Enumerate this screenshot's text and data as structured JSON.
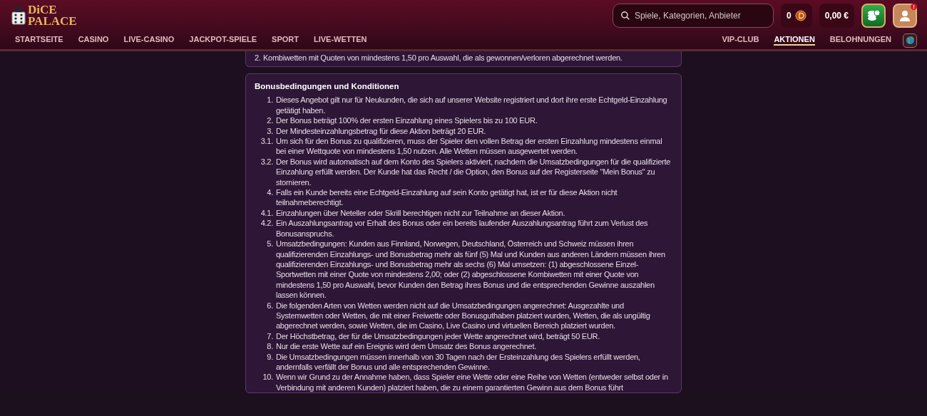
{
  "header": {
    "logo": {
      "line1": "DiCE",
      "line2": "PALACE"
    },
    "search": {
      "placeholder": "Spiele, Kategorien, Anbieter"
    },
    "coins": "0",
    "balance": "0,00 €",
    "notification": "!",
    "nav_left": [
      {
        "label": "STARTSEITE",
        "selected": false
      },
      {
        "label": "CASINO",
        "selected": false
      },
      {
        "label": "LIVE-CASINO",
        "selected": false
      },
      {
        "label": "JACKPOT-SPIELE",
        "selected": false
      },
      {
        "label": "SPORT",
        "selected": false
      },
      {
        "label": "LIVE-WETTEN",
        "selected": false
      }
    ],
    "nav_right": [
      {
        "label": "VIP-CLUB",
        "selected": false
      },
      {
        "label": "AKTIONEN",
        "selected": true
      },
      {
        "label": "BELOHNUNGEN",
        "selected": false
      }
    ]
  },
  "top_card": {
    "items": [
      {
        "number": "2.",
        "text": "Kombiwetten mit Quoten von mindestens 1,50 pro Auswahl, die als gewonnen/verloren abgerechnet werden."
      }
    ]
  },
  "terms_card": {
    "title": "Bonusbedingungen und Konditionen",
    "items": [
      {
        "number": "1.",
        "text": "Dieses Angebot gilt nur für Neukunden, die sich auf unserer Website registriert und dort ihre erste Echtgeld-Einzahlung getätigt haben."
      },
      {
        "number": "2.",
        "text": "Der Bonus beträgt 100% der ersten Einzahlung eines Spielers bis zu 100 EUR."
      },
      {
        "number": "3.",
        "text": "Der Mindesteinzahlungsbetrag für diese Aktion beträgt 20 EUR."
      },
      {
        "number": "3.1.",
        "text": "Um sich für den Bonus zu qualifizieren, muss der Spieler den vollen Betrag der ersten Einzahlung mindestens einmal bei einer Wettquote von mindestens 1,50 nutzen. Alle Wetten müssen ausgewertet werden."
      },
      {
        "number": "3.2.",
        "text": "Der Bonus wird automatisch auf dem Konto des Spielers aktiviert, nachdem die Umsatzbedingungen für die qualifizierte Einzahlung erfüllt werden. Der Kunde hat das Recht / die Option, den Bonus auf der Registerseite \"Mein Bonus\" zu stornieren."
      },
      {
        "number": "4.",
        "text": "Falls ein Kunde bereits eine Echtgeld-Einzahlung auf sein Konto getätigt hat, ist er für diese Aktion nicht teilnahmeberechtigt."
      },
      {
        "number": "4.1.",
        "text": "Einzahlungen über Neteller oder Skrill berechtigen nicht zur Teilnahme an dieser Aktion."
      },
      {
        "number": "4.2.",
        "text": "Ein Auszahlungsantrag vor Erhalt des Bonus oder ein bereits laufender Auszahlungsantrag führt zum Verlust des Bonusanspruchs."
      },
      {
        "number": "5.",
        "text": "Umsatzbedingungen: Kunden aus Finnland, Norwegen, Deutschland, Österreich und Schweiz müssen ihren qualifizierenden Einzahlungs- und Bonusbetrag mehr als fünf (5) Mal und Kunden aus anderen Ländern müssen ihren qualifizierenden Einzahlungs- und Bonusbetrag mehr als sechs (6) Mal umsetzen: (1) abgeschlossene Einzel-Sportwetten mit einer Quote von mindestens 2,00; oder (2) abgeschlossene Kombiwetten mit einer Quote von mindestens 1,50 pro Auswahl, bevor Kunden den Betrag ihres Bonus und die entsprechenden Gewinne auszahlen lassen können."
      },
      {
        "number": "6.",
        "text": "Die folgenden Arten von Wetten werden nicht auf die Umsatzbedingungen angerechnet: Ausgezahlte und Systemwetten oder Wetten, die mit einer Freiwette oder Bonusguthaben platziert wurden, Wetten, die als ungültig abgerechnet werden, sowie Wetten, die im Casino, Live Casino und virtuellen Bereich platziert wurden."
      },
      {
        "number": "7.",
        "text": "Der Höchstbetrag, der für die Umsatzbedingungen jeder Wette angerechnet wird, beträgt 50 EUR."
      },
      {
        "number": "8.",
        "text": "Nur die erste Wette auf ein Ereignis wird dem Umsatz des Bonus angerechnet."
      },
      {
        "number": "9.",
        "text": "Die Umsatzbedingungen müssen innerhalb von 30 Tagen nach der Ersteinzahlung des Spielers erfüllt werden, andernfalls verfällt der Bonus und alle entsprechenden Gewinne."
      },
      {
        "number": "10.",
        "text": "Wenn wir Grund zu der Annahme haben, dass Spieler eine Wette oder eine Reihe von Wetten (entweder selbst oder in Verbindung mit anderen Kunden) platziert haben, die zu einem garantierten Gewinn aus dem Bonus führt"
      }
    ]
  }
}
